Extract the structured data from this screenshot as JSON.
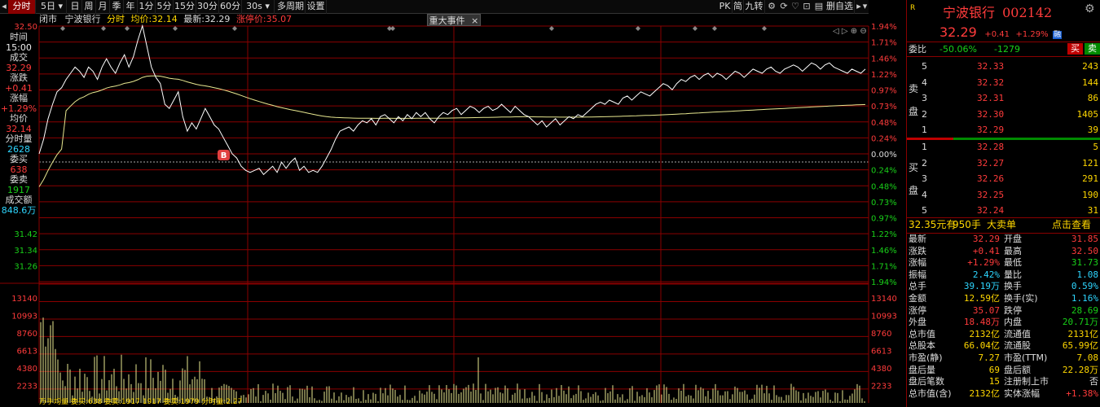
{
  "toolbar": {
    "buttons": [
      "分时",
      "5日",
      "日",
      "周",
      "月",
      "季",
      "年",
      "1分",
      "5分",
      "15分",
      "30分",
      "60分",
      "30s",
      "多周期",
      "设置"
    ],
    "right_buttons": [
      "PK",
      "简",
      "九转",
      "竞",
      "茫",
      "国",
      "叠",
      "删自选"
    ],
    "active": "分时"
  },
  "chart_header": {
    "status": "闭市",
    "name": "宁波银行",
    "mode": "分时",
    "avg_label": "均价:",
    "avg_value": "32.14",
    "last_label": "最新:",
    "last_value": "32.29",
    "limit_label": "涨停价:",
    "limit_value": "35.07",
    "event_tab": "重大事件",
    "event_close": "×"
  },
  "price_axis": {
    "left_top": "32.50",
    "right": [
      "1.94%",
      "1.71%",
      "1.46%",
      "1.22%",
      "0.97%",
      "0.73%",
      "0.48%",
      "0.24%",
      "0.00%",
      "0.24%",
      "0.48%",
      "0.73%",
      "0.97%",
      "1.22%",
      "1.46%",
      "1.71%",
      "1.94%"
    ],
    "left_low": [
      "31.42",
      "31.34",
      "31.26"
    ]
  },
  "volume_axis": [
    "13140",
    "10993",
    "8760",
    "6613",
    "4380",
    "2233"
  ],
  "info_column": [
    {
      "label": "时间",
      "value": "15:00"
    },
    {
      "label": "成交",
      "value": "32.29"
    },
    {
      "label": "涨跌",
      "value": "+0.41"
    },
    {
      "label": "涨幅",
      "value": "+1.29%"
    },
    {
      "label": "均价",
      "value": "32.14"
    },
    {
      "label": "分时量",
      "value": "2628"
    },
    {
      "label": "委买",
      "value": "638"
    },
    {
      "label": "委卖",
      "value": "1917"
    },
    {
      "label": "成交额",
      "value": "848.6万"
    }
  ],
  "marker_b": "B",
  "bottom_strip": "万手均量 委买:638 委卖:1917 1917 委卖:1979 分时量:2.27",
  "right_panel": {
    "r_tag": "R",
    "name": "宁波银行",
    "code": "002142",
    "price": "32.29",
    "change": "+0.41",
    "change_pct": "+1.29%",
    "badge": "融",
    "weibi_label": "委比",
    "weibi": "-50.06%",
    "weicha": "-1279",
    "buy_btn": "买",
    "sell_btn": "卖",
    "sell_side_label": [
      "卖",
      "盘"
    ],
    "buy_side_label": [
      "买",
      "盘"
    ],
    "asks": [
      {
        "level": "5",
        "price": "32.33",
        "vol": "243"
      },
      {
        "level": "4",
        "price": "32.32",
        "vol": "144"
      },
      {
        "level": "3",
        "price": "32.31",
        "vol": "86"
      },
      {
        "level": "2",
        "price": "32.30",
        "vol": "1405"
      },
      {
        "level": "1",
        "price": "32.29",
        "vol": "39"
      }
    ],
    "bids": [
      {
        "level": "1",
        "price": "32.28",
        "vol": "5"
      },
      {
        "level": "2",
        "price": "32.27",
        "vol": "121"
      },
      {
        "level": "3",
        "price": "32.26",
        "vol": "291"
      },
      {
        "level": "4",
        "price": "32.25",
        "vol": "190"
      },
      {
        "level": "5",
        "price": "32.24",
        "vol": "31"
      }
    ],
    "big_order": {
      "price": "32.35元有",
      "qty": "950手",
      "label": "大卖单",
      "link": "点击查看"
    },
    "stats": [
      [
        "最新",
        "32.29",
        "开盘",
        "31.85"
      ],
      [
        "涨跌",
        "+0.41",
        "最高",
        "32.50"
      ],
      [
        "涨幅",
        "+1.29%",
        "最低",
        "31.73"
      ],
      [
        "振幅",
        "2.42%",
        "量比",
        "1.08"
      ],
      [
        "总手",
        "39.19万",
        "换手",
        "0.59%"
      ],
      [
        "金额",
        "12.59亿",
        "换手(实)",
        "1.16%"
      ],
      [
        "涨停",
        "35.07",
        "跌停",
        "28.69"
      ],
      [
        "外盘",
        "18.48万",
        "内盘",
        "20.71万"
      ],
      [
        "总市值",
        "2132亿",
        "流通值",
        "2131亿"
      ],
      [
        "总股本",
        "66.04亿",
        "流通股",
        "65.99亿"
      ],
      [
        "市盈(静)",
        "7.27",
        "市盈(TTM)",
        "7.08"
      ],
      [
        "盘后量",
        "69",
        "盘后额",
        "22.28万"
      ],
      [
        "盘后笔数",
        "15",
        "注册制上市",
        "否"
      ],
      [
        "总市值(含)",
        "2132亿",
        "实体涨幅",
        "+1.38%"
      ]
    ]
  },
  "colors": {
    "up": "#ff3b3b",
    "down": "#19d119",
    "grid": "#8a0000",
    "price_line": "#ffffff",
    "avg_line": "#e8e890",
    "volume": "#e8e890",
    "accent": "#2ed6ff"
  },
  "chart_data": {
    "type": "line",
    "prev_close": 31.88,
    "price": [
      31.88,
      31.95,
      32.05,
      32.12,
      32.18,
      32.2,
      32.24,
      32.27,
      32.3,
      32.28,
      32.25,
      32.3,
      32.28,
      32.24,
      32.3,
      32.34,
      32.3,
      32.27,
      32.32,
      32.36,
      32.3,
      32.35,
      32.43,
      32.5,
      32.4,
      32.3,
      32.25,
      32.22,
      32.12,
      32.1,
      32.14,
      32.18,
      32.06,
      31.99,
      32.03,
      32.0,
      32.05,
      32.1,
      32.06,
      32.02,
      32.0,
      31.96,
      31.92,
      31.88,
      31.86,
      31.82,
      31.8,
      31.79,
      31.8,
      31.81,
      31.78,
      31.8,
      31.82,
      31.79,
      31.84,
      31.81,
      31.84,
      31.86,
      31.8,
      31.82,
      31.79,
      31.8,
      31.79,
      31.82,
      31.86,
      31.9,
      31.95,
      31.99,
      32.0,
      32.01,
      31.99,
      32.02,
      32.04,
      32.03,
      32.05,
      32.02,
      32.06,
      32.07,
      32.05,
      32.03,
      32.06,
      32.04,
      32.07,
      32.05,
      32.08,
      32.06,
      32.08,
      32.05,
      32.03,
      32.06,
      32.08,
      32.07,
      32.09,
      32.1,
      32.07,
      32.09,
      32.11,
      32.1,
      32.08,
      32.1,
      32.11,
      32.09,
      32.1,
      32.12,
      32.1,
      32.08,
      32.11,
      32.09,
      32.07,
      32.06,
      32.04,
      32.02,
      32.04,
      32.01,
      32.03,
      32.05,
      32.02,
      32.04,
      32.06,
      32.05,
      32.07,
      32.06,
      32.08,
      32.1,
      32.12,
      32.13,
      32.12,
      32.14,
      32.13,
      32.12,
      32.15,
      32.16,
      32.14,
      32.16,
      32.18,
      32.17,
      32.16,
      32.18,
      32.2,
      32.22,
      32.21,
      32.19,
      32.22,
      32.24,
      32.23,
      32.25,
      32.26,
      32.24,
      32.26,
      32.27,
      32.25,
      32.27,
      32.26,
      32.24,
      32.26,
      32.28,
      32.27,
      32.25,
      32.27,
      32.29,
      32.28,
      32.27,
      32.29,
      32.3,
      32.28,
      32.27,
      32.29,
      32.3,
      32.31,
      32.3,
      32.28,
      32.3,
      32.32,
      32.31,
      32.29,
      32.31,
      32.32,
      32.3,
      32.29,
      32.28,
      32.27,
      32.29,
      32.28,
      32.27,
      32.29
    ]
  }
}
